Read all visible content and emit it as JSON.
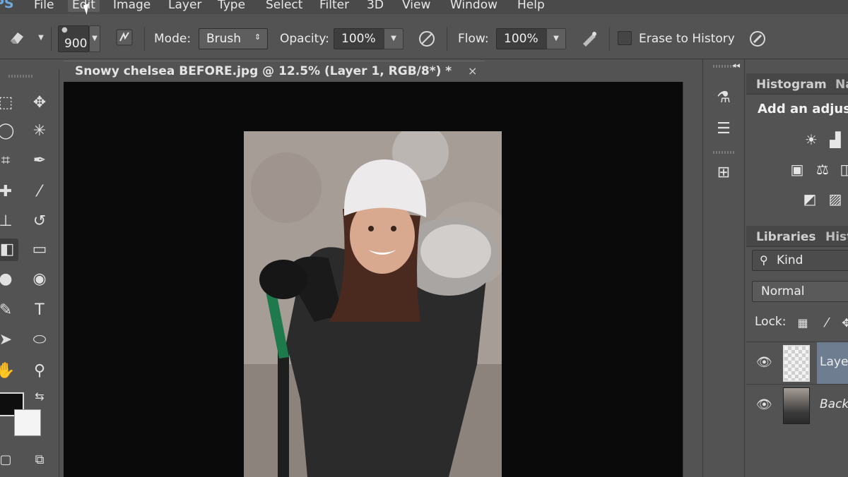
{
  "app": {
    "logo": "PS"
  },
  "menu": [
    "File",
    "Edit",
    "Image",
    "Layer",
    "Type",
    "Select",
    "Filter",
    "3D",
    "View",
    "Window",
    "Help"
  ],
  "options": {
    "brush_size": "900",
    "mode_label": "Mode:",
    "mode_value": "Brush",
    "opacity_label": "Opacity:",
    "opacity_value": "100%",
    "flow_label": "Flow:",
    "flow_value": "100%",
    "erase_history_label": "Erase to History"
  },
  "document": {
    "tab_title": "Snowy chelsea BEFORE.jpg @ 12.5% (Layer 1, RGB/8*) *",
    "close": "×"
  },
  "panels": {
    "tabs_top": [
      "Histogram",
      "Na"
    ],
    "adjustments_title": "Add an adjust",
    "tabs_mid": [
      "Libraries",
      "Hist"
    ],
    "kind_label": "Kind",
    "blend_mode": "Normal",
    "lock_label": "Lock:",
    "layers": [
      {
        "name": "Laye",
        "selected": true
      },
      {
        "name": "Back",
        "selected": false
      }
    ]
  }
}
